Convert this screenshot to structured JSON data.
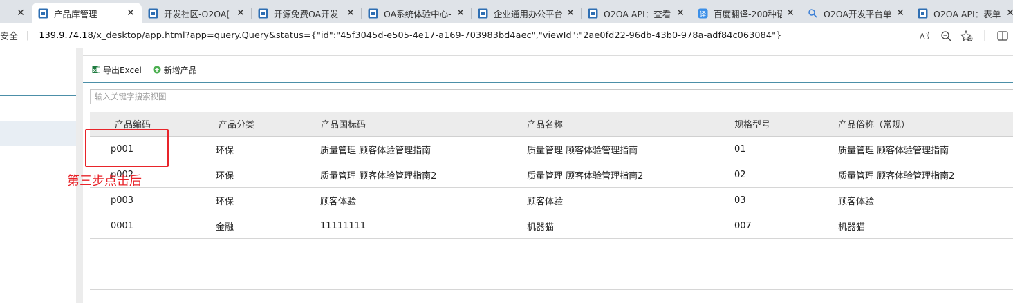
{
  "tabs": [
    {
      "title": "",
      "active": false,
      "icon": "blank"
    },
    {
      "title": "产品库管理",
      "active": true,
      "icon": "o2oa-page-icon"
    },
    {
      "title": "开发社区-O2OA[",
      "active": false,
      "icon": "o2oa-page-icon"
    },
    {
      "title": "开源免费OA开发",
      "active": false,
      "icon": "o2oa-page-icon"
    },
    {
      "title": "OA系统体验中心-",
      "active": false,
      "icon": "o2oa-page-icon"
    },
    {
      "title": "企业通用办公平台",
      "active": false,
      "icon": "o2oa-page-icon"
    },
    {
      "title": "O2OA API：查看",
      "active": false,
      "icon": "o2oa-page-icon"
    },
    {
      "title": "百度翻译-200种语",
      "active": false,
      "icon": "translate-icon"
    },
    {
      "title": "O2OA开发平台单",
      "active": false,
      "icon": "search-icon"
    },
    {
      "title": "O2OA API：表单",
      "active": false,
      "icon": "o2oa-page-icon"
    }
  ],
  "close_glyph": "✕",
  "address": {
    "security": "安全",
    "host": "139.9.74.18",
    "path": "/x_desktop/app.html?app=query.Query&status={\"id\":\"45f3045d-e505-4e17-a169-703983bd4aec\",\"viewId\":\"2ae0fd22-96db-43b0-978a-adf84c063084\"}"
  },
  "toolbar": {
    "export_label": "导出Excel",
    "add_label": "新增产品"
  },
  "search": {
    "placeholder": "输入关键字搜索视图"
  },
  "table": {
    "headers": [
      "产品编码",
      "产品分类",
      "产品国标码",
      "产品名称",
      "规格型号",
      "产品俗称（常规）"
    ],
    "rows": [
      [
        "p001",
        "环保",
        "质量管理 顾客体验管理指南",
        "质量管理 顾客体验管理指南",
        "01",
        "质量管理 顾客体验管理指南"
      ],
      [
        "p002",
        "环保",
        "质量管理 顾客体验管理指南2",
        "质量管理 顾客体验管理指南2",
        "02",
        "质量管理 顾客体验管理指南2"
      ],
      [
        "p003",
        "环保",
        "顾客体验",
        "顾客体验",
        "03",
        "顾客体验"
      ],
      [
        "0001",
        "金融",
        "11111111",
        "机器猫",
        "007",
        "机器猫"
      ],
      [
        "",
        "",
        "",
        "",
        "",
        ""
      ],
      [
        "",
        "",
        "",
        "",
        "",
        ""
      ]
    ]
  },
  "annotation": {
    "text": "第三步点击后"
  },
  "colors": {
    "accent_teal": "#4c8fa8",
    "annotation_red": "#e8242a",
    "excel_green": "#1d7a3e",
    "add_green": "#4caf50"
  }
}
